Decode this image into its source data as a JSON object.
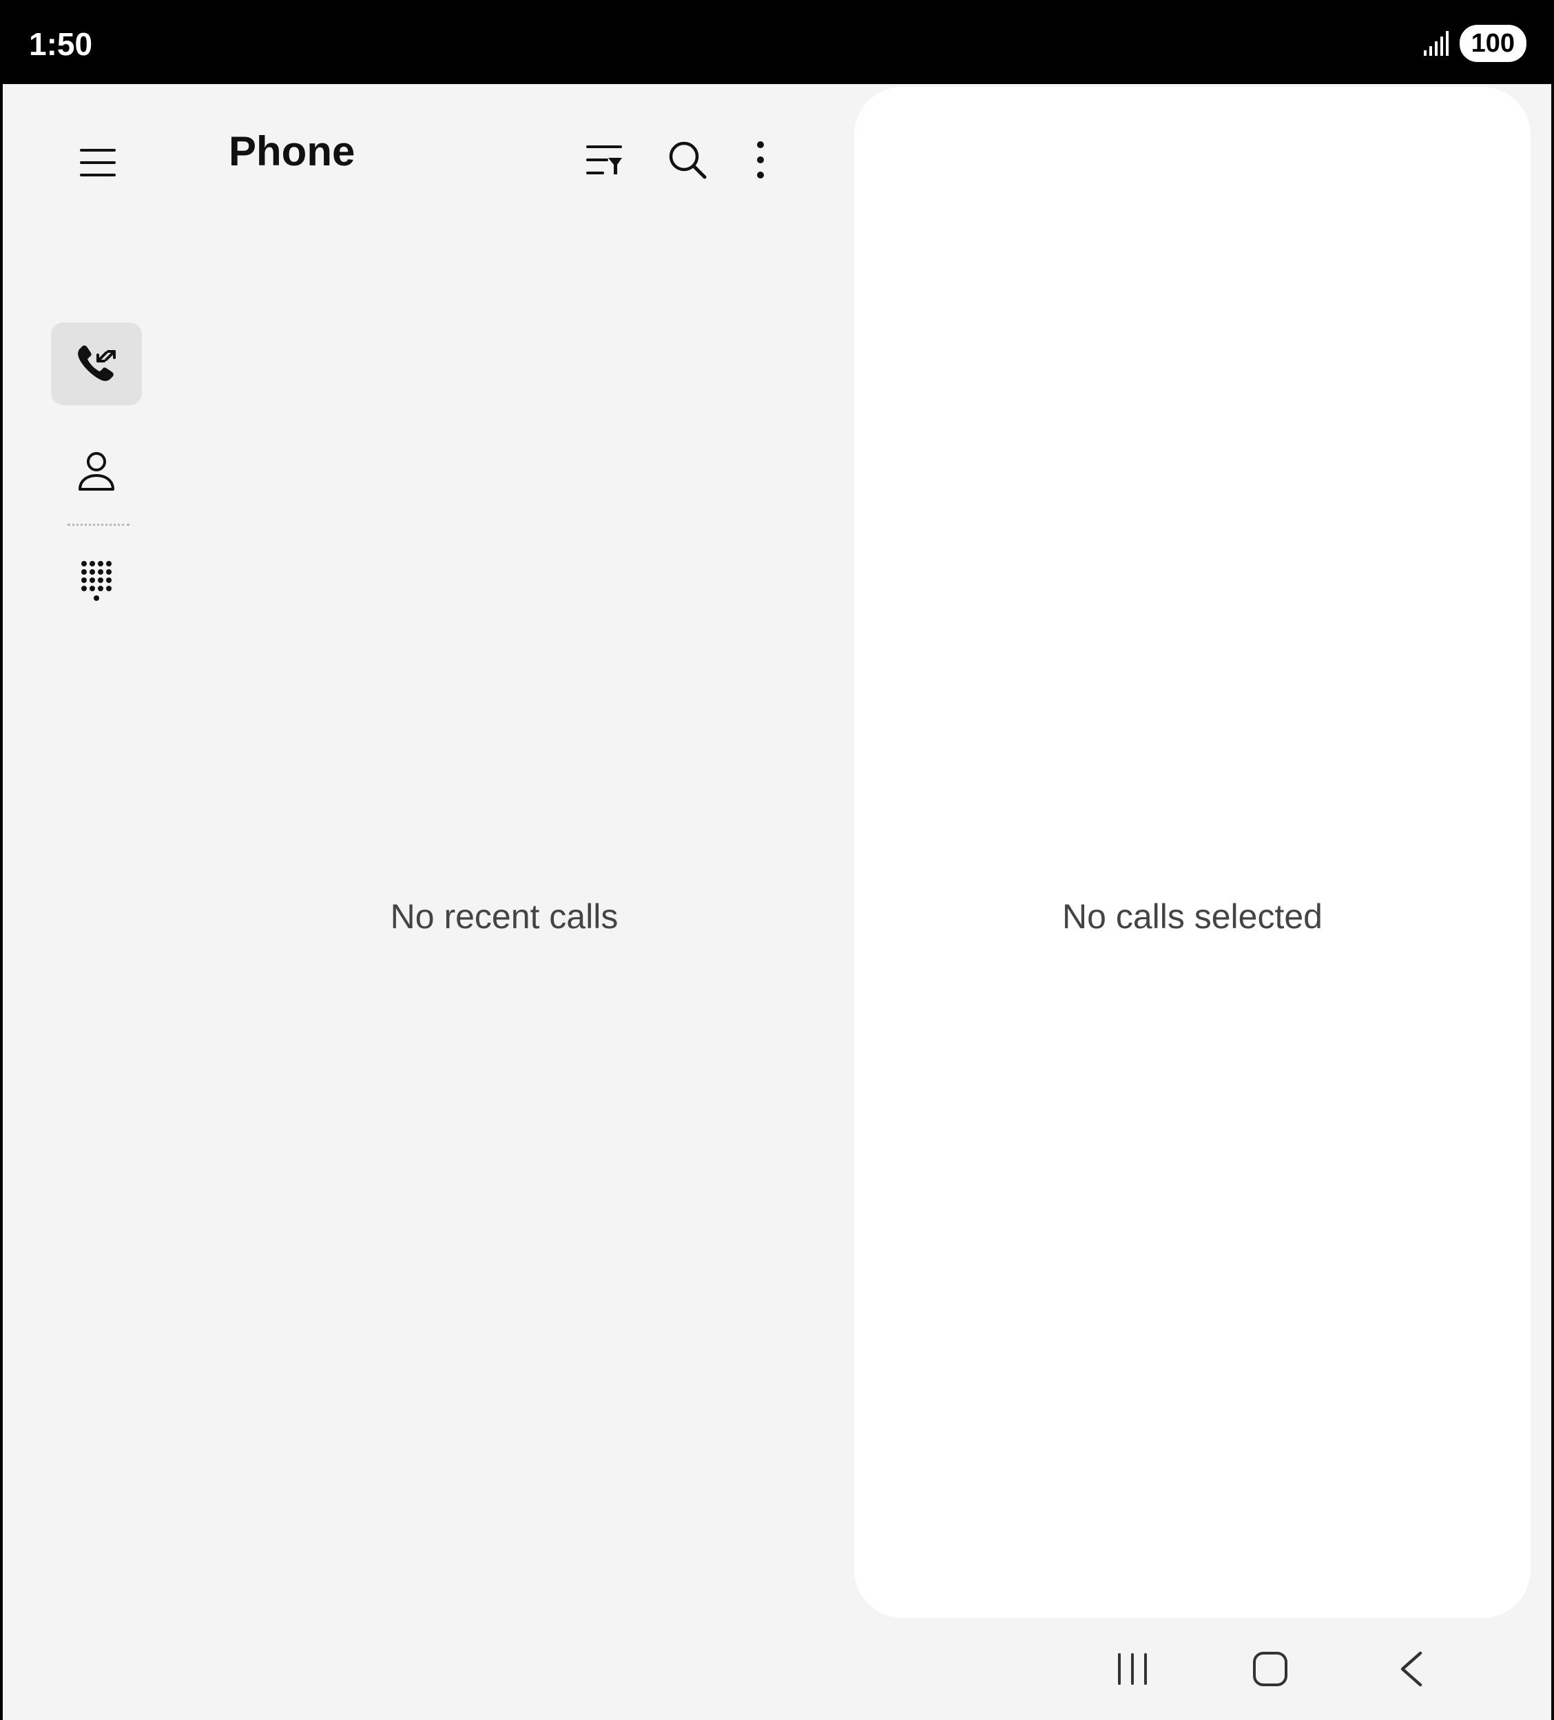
{
  "status_bar": {
    "time": "1:50",
    "battery": "100"
  },
  "header": {
    "title": "Phone",
    "menu_icon": "hamburger-menu-icon",
    "filter_icon": "filter-list-icon",
    "search_icon": "search-icon",
    "more_icon": "more-vertical-icon"
  },
  "nav_rail": {
    "items": [
      {
        "id": "recents",
        "icon": "phone-calls-icon",
        "active": true
      },
      {
        "id": "contacts",
        "icon": "person-icon",
        "active": false
      },
      {
        "id": "keypad",
        "icon": "dialpad-icon",
        "active": false
      }
    ]
  },
  "main": {
    "empty_message": "No recent calls"
  },
  "detail": {
    "empty_message": "No calls selected"
  },
  "system_nav": {
    "recents_icon": "recent-apps-icon",
    "home_icon": "home-icon",
    "back_icon": "back-icon"
  },
  "colors": {
    "background": "#f4f4f5",
    "pane": "#ffffff",
    "active_nav": "#e2e2e3",
    "text": "#111111"
  }
}
